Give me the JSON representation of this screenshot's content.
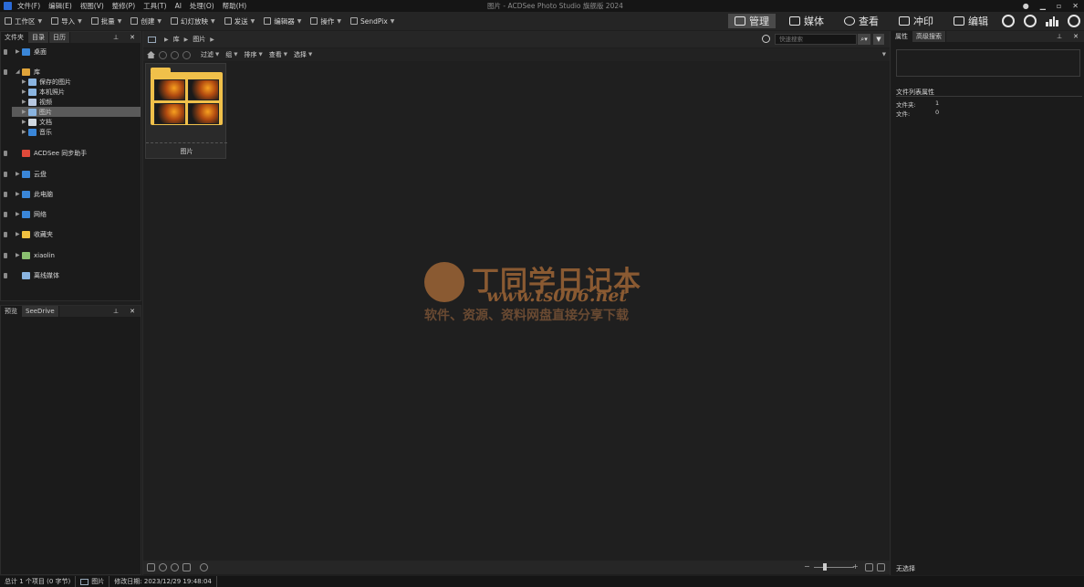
{
  "menubar": {
    "items": [
      "文件(F)",
      "编辑(E)",
      "视图(V)",
      "整修(P)",
      "工具(T)",
      "AI",
      "处理(O)",
      "帮助(H)"
    ],
    "window_title": "图片 - ACDSee Photo Studio 旗舰版 2024"
  },
  "toolbar": {
    "items": [
      {
        "label": "工作区",
        "icon": "workspace-icon"
      },
      {
        "label": "导入",
        "icon": "import-icon"
      },
      {
        "label": "批量",
        "icon": "batch-icon"
      },
      {
        "label": "创建",
        "icon": "create-icon"
      },
      {
        "label": "幻灯放映",
        "icon": "slideshow-icon"
      },
      {
        "label": "发送",
        "icon": "send-icon"
      },
      {
        "label": "编辑器",
        "icon": "editor-icon"
      },
      {
        "label": "操作",
        "icon": "actions-icon"
      },
      {
        "label": "SendPix",
        "icon": "sendpix-icon"
      }
    ]
  },
  "modes": {
    "manage": "管理",
    "media": "媒体",
    "view": "查看",
    "develop": "冲印",
    "edit": "编辑"
  },
  "left_panel": {
    "tabs": [
      "文件夹",
      "目录",
      "日历"
    ],
    "tree": [
      {
        "label": "桌面",
        "icon": "desktop-icon",
        "level": 1,
        "color": "#3a86d8"
      },
      {
        "label": "库",
        "icon": "library-icon",
        "level": 1,
        "color": "#e0a43a"
      },
      {
        "label": "保存的图片",
        "icon": "saved-pictures-icon",
        "level": 2,
        "color": "#8ab4e0"
      },
      {
        "label": "本机照片",
        "icon": "camera-roll-icon",
        "level": 2,
        "color": "#8ab4e0"
      },
      {
        "label": "视频",
        "icon": "videos-icon",
        "level": 2,
        "color": "#b8c8e0"
      },
      {
        "label": "图片",
        "icon": "pictures-icon",
        "level": 2,
        "color": "#8ab4e0",
        "selected": true
      },
      {
        "label": "文档",
        "icon": "documents-icon",
        "level": 2,
        "color": "#d0d8e0"
      },
      {
        "label": "音乐",
        "icon": "music-icon",
        "level": 2,
        "color": "#3a86d8"
      },
      {
        "label": "ACDSee 同步助手",
        "icon": "acdsee-sync-icon",
        "level": 1,
        "color": "#e04a3a"
      },
      {
        "label": "云盘",
        "icon": "cloud-drive-icon",
        "level": 1,
        "color": "#3a86d8"
      },
      {
        "label": "此电脑",
        "icon": "this-pc-icon",
        "level": 1,
        "color": "#3a86d8"
      },
      {
        "label": "网络",
        "icon": "network-icon",
        "level": 1,
        "color": "#3a86d8"
      },
      {
        "label": "收藏夹",
        "icon": "favorites-icon",
        "level": 1,
        "color": "#f0c040"
      },
      {
        "label": "xiaolin",
        "icon": "user-folder-icon",
        "level": 1,
        "color": "#8ac070"
      },
      {
        "label": "离线媒体",
        "icon": "offline-media-icon",
        "level": 1,
        "color": "#8ab4e0"
      }
    ]
  },
  "preview_panel": {
    "tabs": [
      "预览",
      "SeeDrive"
    ]
  },
  "content": {
    "path": [
      "库",
      "图片"
    ],
    "search_placeholder": "快速搜索",
    "nav_menus": [
      "过滤",
      "组",
      "排序",
      "查看",
      "选择"
    ],
    "thumbnail_label": "图片"
  },
  "watermark": {
    "title": "丁同学日记本",
    "url": "www.ts006.net",
    "subtitle": "软件、资源、资料网盘直接分享下载"
  },
  "properties": {
    "tabs": [
      "属性",
      "高级搜索"
    ],
    "section_title": "文件列表属性",
    "rows": [
      {
        "key": "文件夹:",
        "value": "1"
      },
      {
        "key": "文件:",
        "value": "0"
      }
    ],
    "no_selection": "无选择"
  },
  "statusbar": {
    "total": "总计 1 个项目 (0 字节)",
    "current": "图片",
    "modified": "修改日期: 2023/12/29 19:48:04"
  }
}
